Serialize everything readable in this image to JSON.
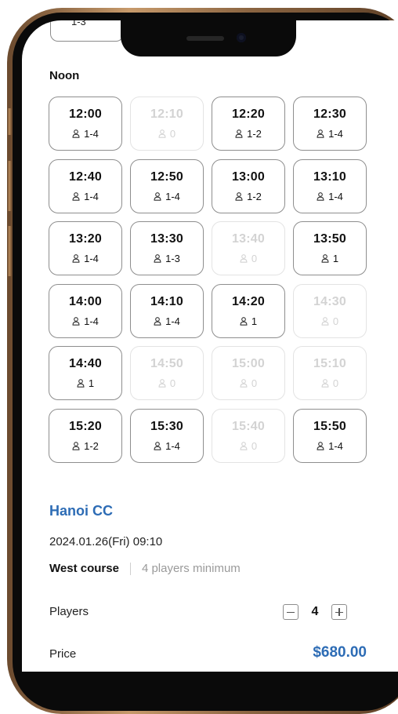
{
  "previous_slot_partial": "1-3",
  "section": {
    "title": "Noon"
  },
  "slots": [
    {
      "time": "12:00",
      "cap": "1-4",
      "available": true
    },
    {
      "time": "12:10",
      "cap": "0",
      "available": false
    },
    {
      "time": "12:20",
      "cap": "1-2",
      "available": true
    },
    {
      "time": "12:30",
      "cap": "1-4",
      "available": true
    },
    {
      "time": "12:40",
      "cap": "1-4",
      "available": true
    },
    {
      "time": "12:50",
      "cap": "1-4",
      "available": true
    },
    {
      "time": "13:00",
      "cap": "1-2",
      "available": true
    },
    {
      "time": "13:10",
      "cap": "1-4",
      "available": true
    },
    {
      "time": "13:20",
      "cap": "1-4",
      "available": true
    },
    {
      "time": "13:30",
      "cap": "1-3",
      "available": true
    },
    {
      "time": "13:40",
      "cap": "0",
      "available": false
    },
    {
      "time": "13:50",
      "cap": "1",
      "available": true
    },
    {
      "time": "14:00",
      "cap": "1-4",
      "available": true
    },
    {
      "time": "14:10",
      "cap": "1-4",
      "available": true
    },
    {
      "time": "14:20",
      "cap": "1",
      "available": true
    },
    {
      "time": "14:30",
      "cap": "0",
      "available": false
    },
    {
      "time": "14:40",
      "cap": "1",
      "available": true
    },
    {
      "time": "14:50",
      "cap": "0",
      "available": false
    },
    {
      "time": "15:00",
      "cap": "0",
      "available": false
    },
    {
      "time": "15:10",
      "cap": "0",
      "available": false
    },
    {
      "time": "15:20",
      "cap": "1-2",
      "available": true
    },
    {
      "time": "15:30",
      "cap": "1-4",
      "available": true
    },
    {
      "time": "15:40",
      "cap": "0",
      "available": false
    },
    {
      "time": "15:50",
      "cap": "1-4",
      "available": true
    }
  ],
  "booking": {
    "club": "Hanoi CC",
    "datetime": "2024.01.26(Fri) 09:10",
    "course": "West course",
    "minimum": "4 players minimum",
    "players_label": "Players",
    "players_value": "4",
    "price_label": "Price",
    "price_value": "$680.00"
  },
  "colors": {
    "accent": "#2d6cb5",
    "frame": "#c79a6b",
    "slot_border": "#8e8e8e",
    "slot_disabled": "#d3d3d3"
  },
  "icons": {
    "capacity": "person-icon",
    "decrement": "minus-icon",
    "increment": "plus-icon"
  }
}
